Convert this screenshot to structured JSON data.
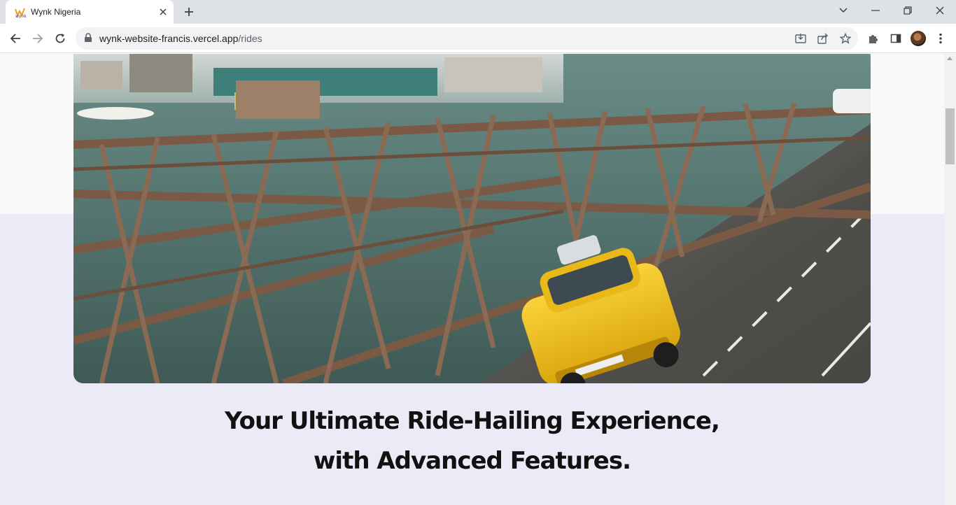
{
  "tab": {
    "title": "Wynk Nigeria",
    "favicon": "wynk-logo-icon"
  },
  "address_bar": {
    "host": "wynk-website-francis.vercel.app",
    "path": "/rides"
  },
  "page": {
    "headline_line1": "Your Ultimate Ride-Hailing Experience,",
    "headline_line2": "with Advanced Features.",
    "hero_image": "bridge-with-yellow-taxi"
  },
  "colors": {
    "tabstrip": "#dee1e6",
    "page_background": "#ebeaf7",
    "top_band": "#f9f9f9",
    "taxi": "#f5c518"
  }
}
